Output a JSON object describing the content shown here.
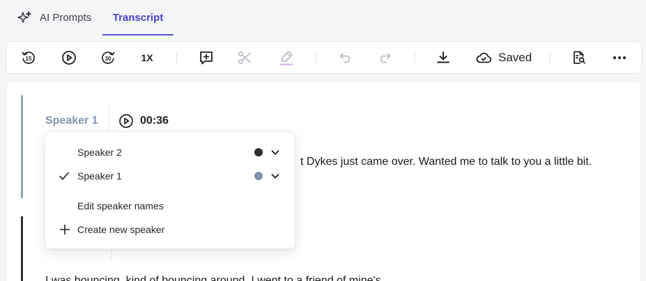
{
  "tabs": {
    "ai_prompts": "AI Prompts",
    "transcript": "Transcript",
    "active": "Transcript"
  },
  "toolbar": {
    "rewind_icon": "rewind-15-icon",
    "play_icon": "play-circle-icon",
    "forward_icon": "forward-30-icon",
    "speed_label": "1X",
    "add_comment_icon": "add-comment-icon",
    "cut_icon": "scissors-icon",
    "highlight_icon": "highlighter-icon",
    "undo_icon": "undo-icon",
    "redo_icon": "redo-icon",
    "download_icon": "download-icon",
    "saved_label": "Saved",
    "search_doc_icon": "document-search-icon",
    "more_icon": "more-horizontal-icon"
  },
  "transcript": {
    "speaker_label": "Speaker 1",
    "timestamp": "00:36",
    "segment_1_text": "t Dykes just came over. Wanted me to talk to you a little bit.",
    "segment_2_text": "I was bouncing, kind of bouncing around. I went to a friend of mine's"
  },
  "speaker_menu": {
    "items": [
      {
        "label": "Speaker 2",
        "color": "#2b2e33",
        "selected": false
      },
      {
        "label": "Speaker 1",
        "color": "#7f93ae",
        "selected": true
      }
    ],
    "edit_names": "Edit speaker names",
    "create_new": "Create new speaker"
  },
  "colors": {
    "accent": "#5b4fd1",
    "speaker_1": "#8fa1b8",
    "speaker_2": "#2b2e33",
    "disabled_icon": "#b9bdc4"
  }
}
